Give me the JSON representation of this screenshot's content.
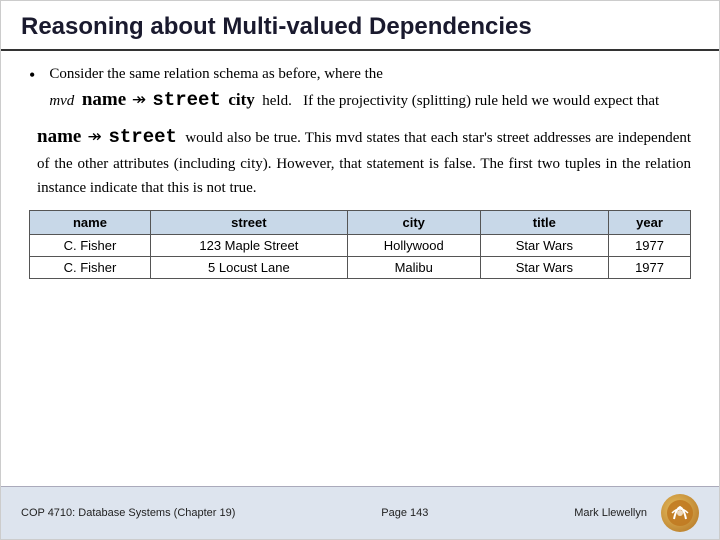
{
  "header": {
    "title": "Reasoning about Multi-valued Dependencies"
  },
  "body": {
    "bullet1": "Consider the same relation schema as before, where the",
    "mvd_formula_line": "mvd  name  ↠  street  city  held.   If the projectivity (splitting) rule held we would expect that",
    "paragraph": "would also be true.  This mvd states that each star’s street addresses are independent of the other attributes (including city).  However, that statement is false.  The first two tuples in the relation instance indicate that this is not true.",
    "table": {
      "headers": [
        "name",
        "street",
        "city",
        "title",
        "year"
      ],
      "rows": [
        [
          "C. Fisher",
          "123 Maple Street",
          "Hollywood",
          "Star Wars",
          "1977"
        ],
        [
          "C. Fisher",
          "5 Locust Lane",
          "Malibu",
          "Star Wars",
          "1977"
        ]
      ]
    }
  },
  "footer": {
    "left": "COP 4710: Database Systems  (Chapter 19)",
    "center": "Page 143",
    "right": "Mark Llewellyn"
  }
}
